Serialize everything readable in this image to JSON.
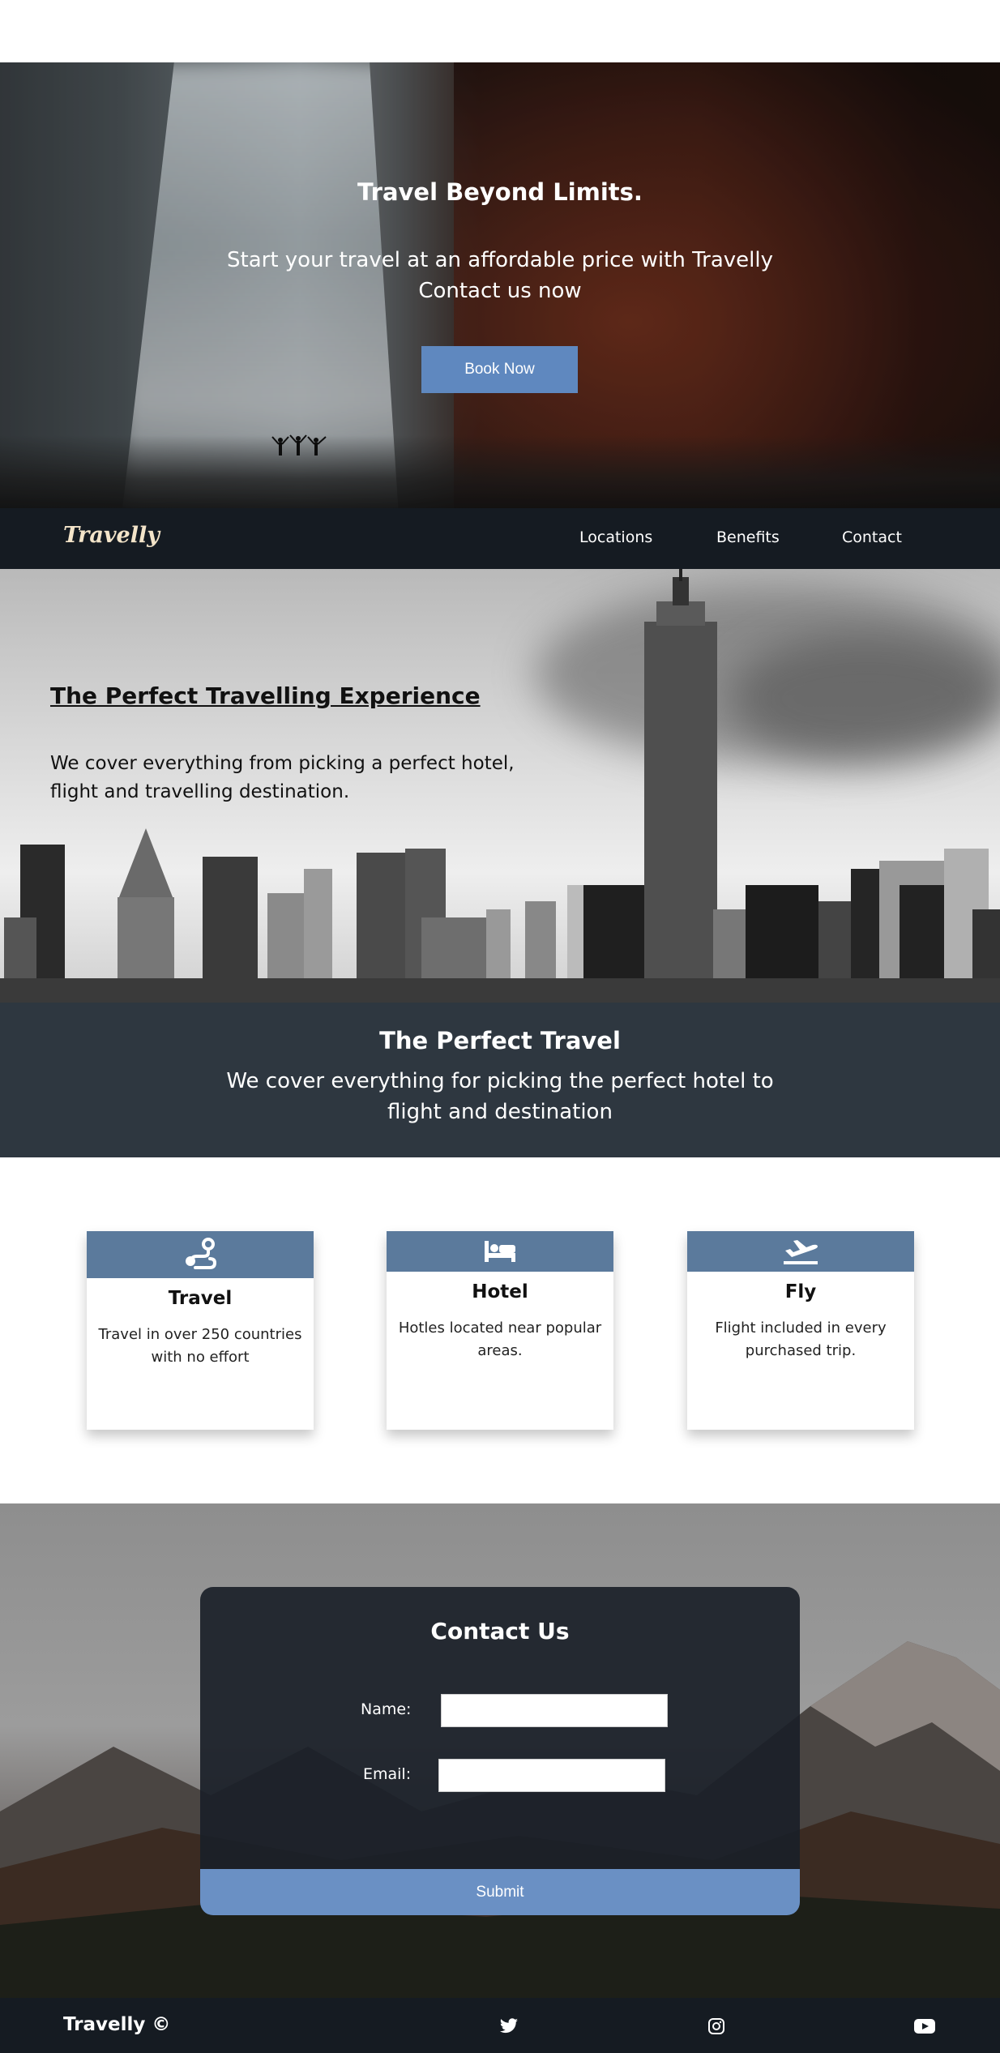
{
  "hero": {
    "title": "Travel Beyond Limits.",
    "subtitle": "Start your travel at an affordable price with Travelly Contact us now",
    "button_label": "Book Now"
  },
  "nav": {
    "logo": "Travelly",
    "links": [
      "Locations",
      "Benefits",
      "Contact"
    ]
  },
  "experience": {
    "title": "The Perfect Travelling Experience",
    "text": "We cover everything from picking a perfect hotel, flight and travelling destination."
  },
  "band": {
    "title": "The Perfect Travel",
    "text": "We cover everything for picking the perfect hotel to flight and destination"
  },
  "features": [
    {
      "icon": "route-icon",
      "title": "Travel",
      "text": "Travel in over 250 countries with no effort"
    },
    {
      "icon": "bed-icon",
      "title": "Hotel",
      "text": "Hotles located near popular areas."
    },
    {
      "icon": "plane-departure-icon",
      "title": "Fly",
      "text": "Flight included in every purchased trip."
    }
  ],
  "contact": {
    "title": "Contact Us",
    "name_label": "Name:",
    "email_label": "Email:",
    "name_value": "",
    "email_value": "",
    "submit_label": "Submit"
  },
  "footer": {
    "brand": "Travelly ©",
    "social_icons": [
      "twitter-icon",
      "instagram-icon",
      "youtube-icon"
    ]
  },
  "colors": {
    "accent": "#5f88bf",
    "nav_bg": "#151b22",
    "band_bg": "#2e3740",
    "card_head": "#5b7a9c",
    "submit": "#6a90c4"
  }
}
